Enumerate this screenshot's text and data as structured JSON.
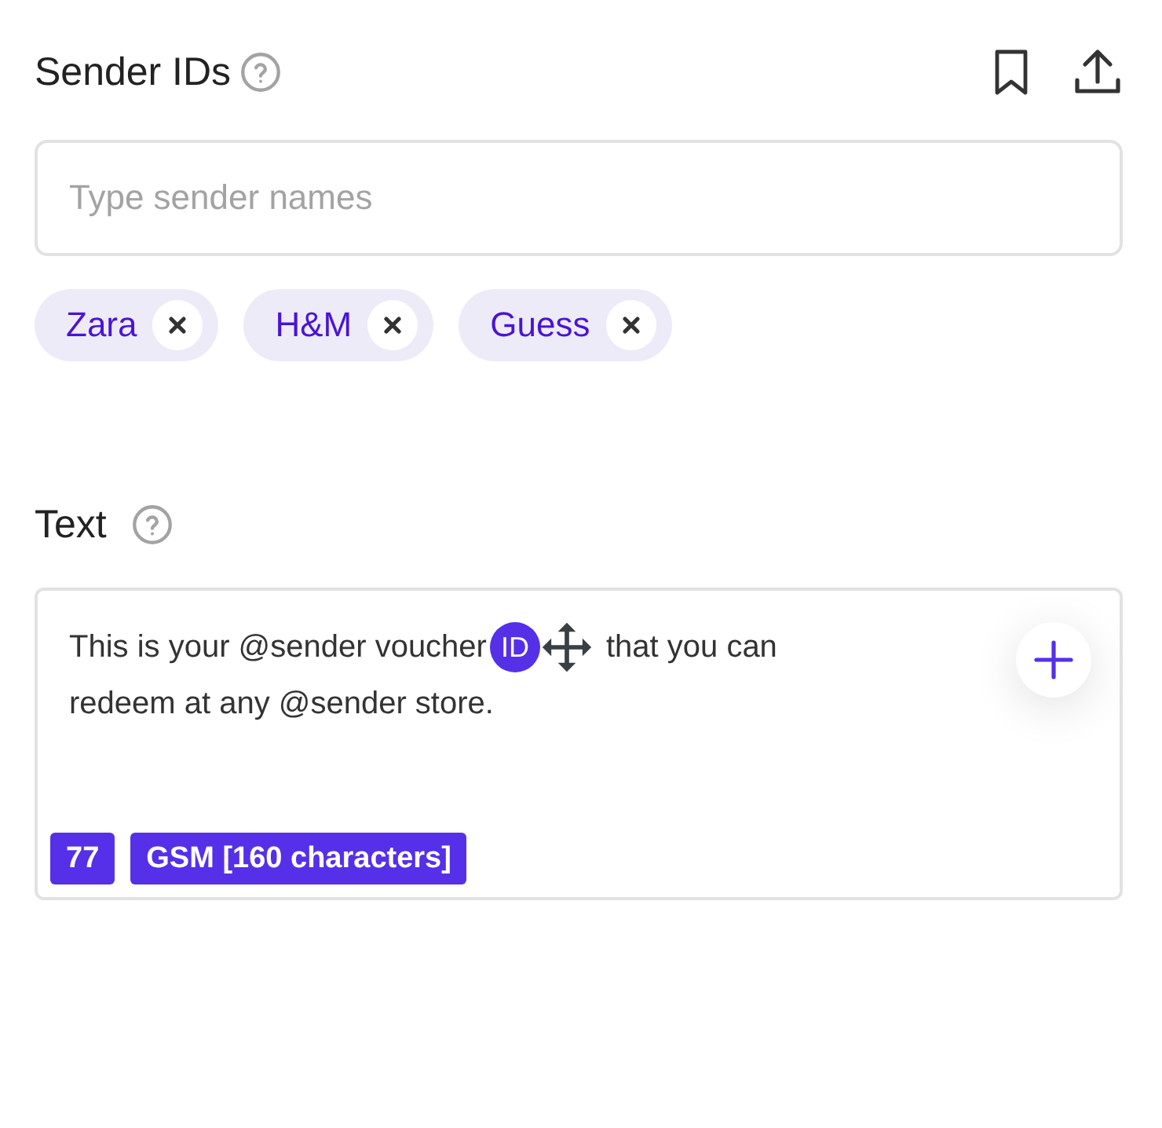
{
  "sender_ids": {
    "title": "Sender IDs",
    "input": {
      "placeholder": "Type sender names"
    },
    "chips": [
      {
        "label": "Zara"
      },
      {
        "label": "H&M"
      },
      {
        "label": "Guess"
      }
    ]
  },
  "text": {
    "title": "Text",
    "message_before": "This is your @sender voucher",
    "token": "ID",
    "message_lines": [
      "that you can",
      "redeem at any @sender store."
    ],
    "counter": "77",
    "encoding": "GSM [160 characters]"
  }
}
